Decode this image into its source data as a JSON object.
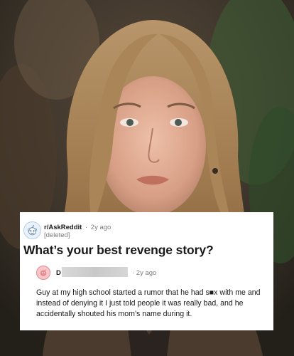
{
  "post": {
    "subreddit": "r/AskReddit",
    "separator": "·",
    "time_ago": "2y ago",
    "author": "[deleted]",
    "title": "What’s your best revenge story?"
  },
  "comment": {
    "author_initial": "D",
    "time_ago": "· 2y ago",
    "body": "Guy at my high school started a rumor that he had s■x with me and instead of denying it I just told people it was really bad, and he accidentally shouted his mom's name during it."
  },
  "colors": {
    "card_bg": "#ffffff",
    "text": "#1a1a1b",
    "meta": "#7c7c7c",
    "redaction": "#cccccc"
  },
  "icons": [
    "reddit-snoo-icon",
    "comment-avatar-icon"
  ]
}
